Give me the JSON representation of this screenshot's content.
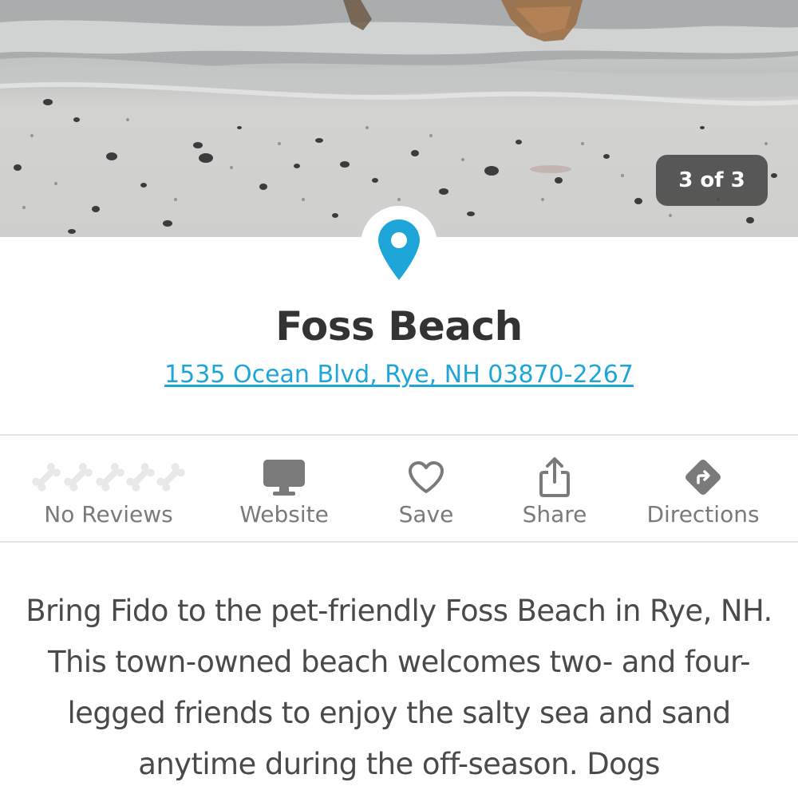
{
  "hero": {
    "photo_counter": "3 of 3"
  },
  "place": {
    "name": "Foss Beach",
    "address": "1535 Ocean Blvd, Rye, NH 03870-2267"
  },
  "actions": {
    "reviews_label": "No Reviews",
    "website_label": "Website",
    "save_label": "Save",
    "share_label": "Share",
    "directions_label": "Directions",
    "rating_value": 0,
    "rating_max": 5
  },
  "description": "Bring Fido to the pet-friendly Foss Beach in Rye, NH. This town-owned beach welcomes two- and four-legged friends to enjoy the salty sea and sand anytime during the off-season. Dogs",
  "colors": {
    "accent": "#1ea6d9",
    "title": "#333333",
    "icon_gray": "#7a7a7a",
    "empty_bone": "#e8e8e8",
    "divider": "#e3e3e3"
  },
  "icons": {
    "location": "map-pin-icon",
    "website": "monitor-icon",
    "save": "heart-icon",
    "share": "share-icon",
    "directions": "directions-icon",
    "rating": "bone-icon"
  }
}
